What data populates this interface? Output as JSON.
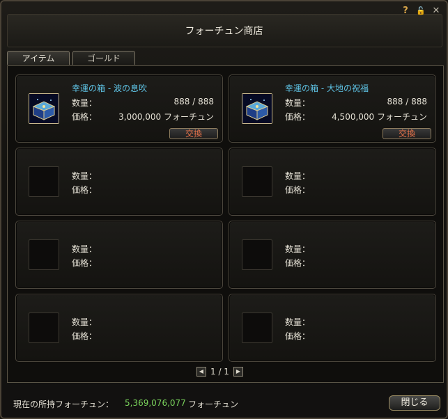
{
  "window": {
    "title": "フォーチュン商店",
    "icons": [
      {
        "name": "help-icon",
        "glyph": "?",
        "color": "#d9a64a"
      },
      {
        "name": "lock-icon",
        "glyph": "🔓",
        "color": "#d9a64a"
      },
      {
        "name": "close-icon",
        "glyph": "✕",
        "color": "#b8b2a4"
      }
    ]
  },
  "tabs": [
    {
      "label": "アイテム",
      "active": true
    },
    {
      "label": "ゴールド",
      "active": false
    }
  ],
  "labels": {
    "quantity": "数量：",
    "price": "価格："
  },
  "items": [
    {
      "name": "幸運の箱 - 波の息吹",
      "quantity": "888 / 888",
      "price": "3,000,000 フォーチュン",
      "exchange_label": "交換",
      "icon": "treasure-box-icon"
    },
    {
      "name": "幸運の箱 - 大地の祝福",
      "quantity": "888 / 888",
      "price": "4,500,000 フォーチュン",
      "exchange_label": "交換",
      "icon": "treasure-box-icon"
    }
  ],
  "pager": {
    "text": "1 / 1",
    "prev_glyph": "◀",
    "next_glyph": "▶"
  },
  "footer": {
    "label": "現在の所持フォーチュン：",
    "amount": "5,369,076,077",
    "unit": "フォーチュン",
    "close_label": "閉じる"
  },
  "colors": {
    "item_name": "#5fc4e6",
    "amount": "#7ad35c",
    "exchange": "#e8734a"
  }
}
